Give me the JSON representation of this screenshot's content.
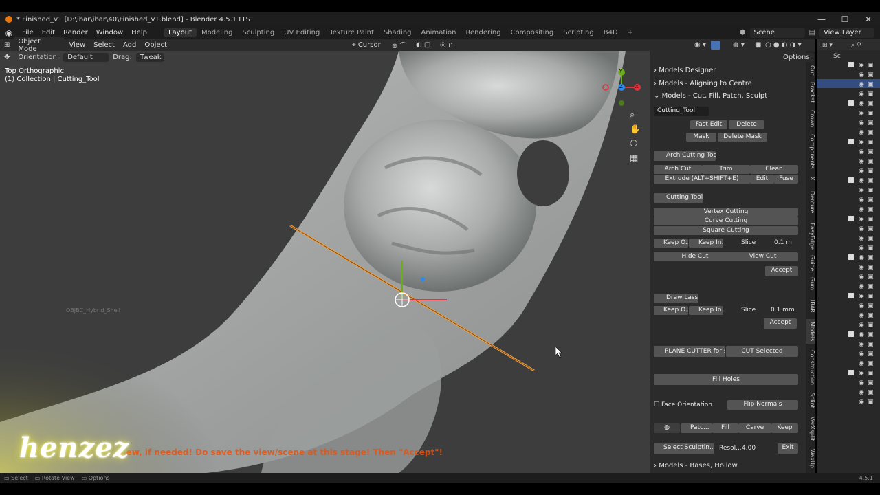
{
  "window": {
    "title": "* Finished_v1 [D:\\ibar\\ibar\\40\\Finished_v1.blend] - Blender 4.5.1 LTS",
    "controls": [
      "—",
      "☐",
      "✕"
    ]
  },
  "menubar": {
    "items": [
      "File",
      "Edit",
      "Render",
      "Window",
      "Help"
    ],
    "workspaces": [
      "Layout",
      "Modeling",
      "Sculpting",
      "UV Editing",
      "Texture Paint",
      "Shading",
      "Animation",
      "Rendering",
      "Compositing",
      "Scripting",
      "B4D"
    ],
    "active_workspace": "Layout",
    "add_tab": "+",
    "scene": "Scene",
    "view_layer": "View Layer"
  },
  "header": {
    "mode": "Object Mode",
    "menus": [
      "View",
      "Select",
      "Add",
      "Object"
    ],
    "transform_pivot": "Cursor",
    "orientation_label": "Orientation:",
    "orientation_value": "Default",
    "drag_label": "Drag:",
    "drag_value": "Tweak",
    "options": "Options"
  },
  "viewport": {
    "view_name": "Top Orthographic",
    "collection": "(1) Collection | Cutting_Tool",
    "object_label": "OBJBC_Hybrid_Shell",
    "gizmo_axes": [
      "Y",
      "Z",
      "X"
    ]
  },
  "npanel": {
    "models_designer": "Models Designer",
    "aligning": "Models - Aligning to Centre",
    "cut_fill": "Models - Cut, Fill, Patch, Sculpt",
    "active_object": "Cutting_Tool",
    "fast_edit": "Fast Edit",
    "delete": "Delete",
    "mask": "Mask",
    "delete_mask": "Delete Mask",
    "arch_cutting_tool": "Arch Cutting Tool",
    "arch_cut": "Arch Cut",
    "trim": "Trim",
    "clean": "Clean",
    "extrude": "Extrude  (ALT+SHIFT+E)",
    "edit": "Edit",
    "fuse": "Fuse",
    "cutting_tools": "Cutting Tools",
    "vertex_cutting": "Vertex Cutting",
    "curve_cutting": "Curve Cutting",
    "square_cutting": "Square Cutting",
    "keep_o": "Keep O...",
    "keep_in": "Keep In...",
    "slice": "Slice",
    "slice_value_1": "0.1 m",
    "hide_cut": "Hide Cut",
    "view_cut": "View Cut",
    "accept": "Accept",
    "draw_lasso": "Draw Lasso",
    "slice_value_2": "0.1 mm",
    "plane_cutter": "PLANE CUTTER for s...",
    "cut_selected": "CUT Selected",
    "fill_holes": "Fill Holes",
    "face_orientation": "Face Orientation",
    "flip_normals": "Flip Normals",
    "patch": "Patc...",
    "fill": "Fill",
    "carve": "Carve",
    "keep": "Keep",
    "select_sculpting": "Select Sculptin...",
    "resol_label": "Resol...",
    "resol_value": "4.00",
    "exit": "Exit",
    "bases_hollow": "Models - Bases, Hollow"
  },
  "side_tabs": [
    "Out",
    "Bracket",
    "Crown",
    "Components",
    "X",
    "Denture",
    "EasyEdge",
    "Guide",
    "Gum",
    "IBAR",
    "Models",
    "Construction",
    "Splint",
    "VerXsplit",
    "WaxUp"
  ],
  "outliner": {
    "label": "Sc"
  },
  "statusbar": {
    "items": [
      "Select",
      "Rotate View",
      "Options"
    ],
    "version": "4.5.1"
  },
  "overlay": {
    "watermark": "henzez",
    "hint": "...ew, if needed! Do save the view/scene at this stage! Then \"Accept\"!"
  },
  "colors": {
    "accent_blue": "#4772b3",
    "orange": "#e8750b",
    "x_axis": "#e0343f",
    "y_axis": "#6fab21",
    "z_axis": "#2d8ceb"
  }
}
